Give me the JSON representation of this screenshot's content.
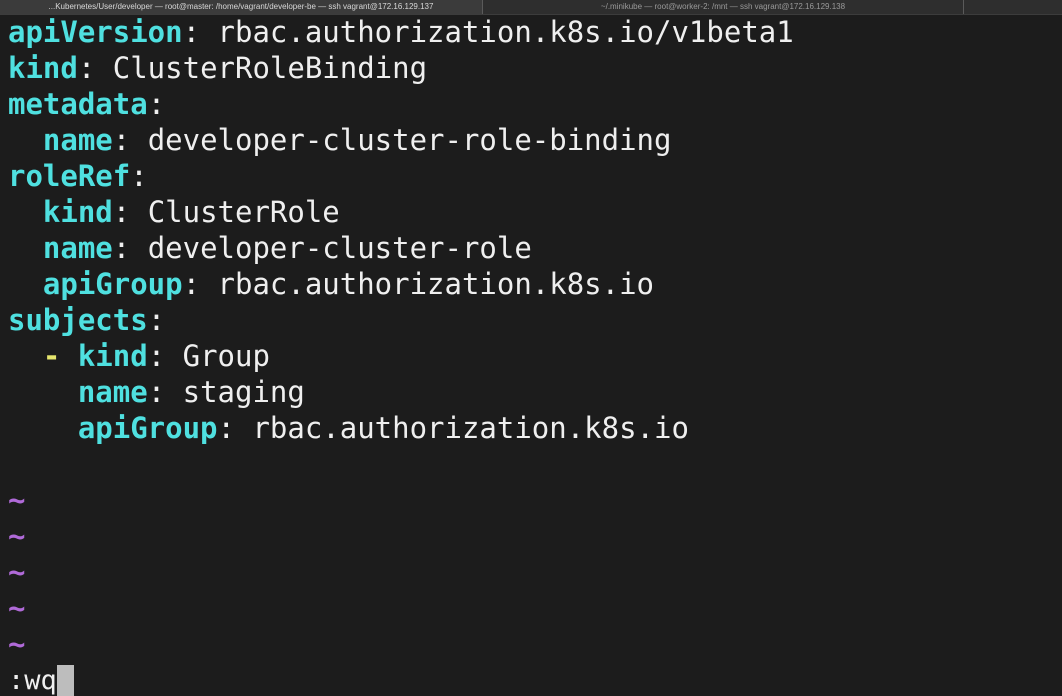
{
  "tabs": [
    {
      "label": "...Kubernetes/User/developer — root@master: /home/vagrant/developer-be — ssh vagrant@172.16.129.137",
      "active": true
    },
    {
      "label": "~/.minikube — root@worker-2: /mnt — ssh vagrant@172.16.129.138",
      "active": false
    }
  ],
  "editor": {
    "lines": [
      {
        "indent": "",
        "dash": "",
        "key": "apiVersion",
        "sep": ": ",
        "value": "rbac.authorization.k8s.io/v1beta1"
      },
      {
        "indent": "",
        "dash": "",
        "key": "kind",
        "sep": ": ",
        "value": "ClusterRoleBinding"
      },
      {
        "indent": "",
        "dash": "",
        "key": "metadata",
        "sep": ":",
        "value": ""
      },
      {
        "indent": "  ",
        "dash": "",
        "key": "name",
        "sep": ": ",
        "value": "developer-cluster-role-binding"
      },
      {
        "indent": "",
        "dash": "",
        "key": "roleRef",
        "sep": ":",
        "value": ""
      },
      {
        "indent": "  ",
        "dash": "",
        "key": "kind",
        "sep": ": ",
        "value": "ClusterRole"
      },
      {
        "indent": "  ",
        "dash": "",
        "key": "name",
        "sep": ": ",
        "value": "developer-cluster-role"
      },
      {
        "indent": "  ",
        "dash": "",
        "key": "apiGroup",
        "sep": ": ",
        "value": "rbac.authorization.k8s.io"
      },
      {
        "indent": "",
        "dash": "",
        "key": "subjects",
        "sep": ":",
        "value": ""
      },
      {
        "indent": "  ",
        "dash": "- ",
        "key": "kind",
        "sep": ": ",
        "value": "Group"
      },
      {
        "indent": "    ",
        "dash": "",
        "key": "name",
        "sep": ": ",
        "value": "staging"
      },
      {
        "indent": "    ",
        "dash": "",
        "key": "apiGroup",
        "sep": ": ",
        "value": "rbac.authorization.k8s.io"
      }
    ],
    "blank_lines": 1,
    "tilde_char": "~",
    "tilde_count": 5
  },
  "command_line": {
    "text": ":wq"
  },
  "colors": {
    "background": "#1c1c1c",
    "key": "#4fe0e0",
    "text": "#efefef",
    "dash": "#e6e66e",
    "tilde": "#b06ad8",
    "cursor": "#bdbdbd"
  }
}
